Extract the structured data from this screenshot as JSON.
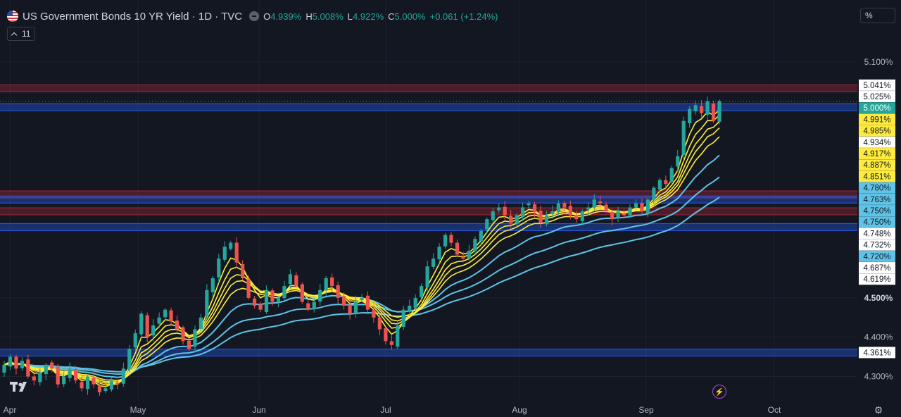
{
  "header": {
    "title": "US Government Bonds 10 YR Yield · 1D · TVC",
    "open_label": "O",
    "open": "4.939%",
    "high_label": "H",
    "high": "5.008%",
    "low_label": "L",
    "low": "4.922%",
    "close_label": "C",
    "close": "5.000%",
    "change": "+0.061 (+1.24%)",
    "indicator_count": "11",
    "scale_mode": "%"
  },
  "colors": {
    "background": "#131722",
    "up": "#26a69a",
    "down": "#ef5350",
    "ema_fast": "#ffeb3b",
    "ema_slow": "#5ec3e6",
    "resistance_band": "#b2283a",
    "support_band": "#2962ff"
  },
  "chart_data": {
    "type": "candlestick",
    "x_tick_labels": [
      "Apr",
      "May",
      "Jun",
      "Jul",
      "Aug",
      "Sep",
      "Oct"
    ],
    "y_tick_labels": [
      "5.100%",
      "4.500%",
      "4.400%",
      "4.300%"
    ],
    "ylim": [
      4.2,
      5.2
    ],
    "last_price": 5.0,
    "price_badges": [
      {
        "label": "5.041%",
        "value": 5.041,
        "style": "white"
      },
      {
        "label": "5.025%",
        "value": 5.025,
        "style": "white"
      },
      {
        "label": "5.000%",
        "value": 5.0,
        "style": "green"
      },
      {
        "label": "4.991%",
        "value": 4.991,
        "style": "yellow"
      },
      {
        "label": "4.985%",
        "value": 4.985,
        "style": "yellow"
      },
      {
        "label": "4.934%",
        "value": 4.934,
        "style": "white"
      },
      {
        "label": "4.917%",
        "value": 4.917,
        "style": "yellow"
      },
      {
        "label": "4.887%",
        "value": 4.887,
        "style": "yellow"
      },
      {
        "label": "4.851%",
        "value": 4.851,
        "style": "yellow"
      },
      {
        "label": "4.780%",
        "value": 4.78,
        "style": "blue"
      },
      {
        "label": "4.763%",
        "value": 4.763,
        "style": "blue"
      },
      {
        "label": "4.750%",
        "value": 4.75,
        "style": "blue"
      },
      {
        "label": "4.750%",
        "value": 4.75,
        "style": "blue"
      },
      {
        "label": "4.748%",
        "value": 4.748,
        "style": "white"
      },
      {
        "label": "4.732%",
        "value": 4.732,
        "style": "white"
      },
      {
        "label": "4.720%",
        "value": 4.72,
        "style": "blue"
      },
      {
        "label": "4.687%",
        "value": 4.687,
        "style": "white"
      },
      {
        "label": "4.619%",
        "value": 4.619,
        "style": "white"
      },
      {
        "label": "4.361%",
        "value": 4.361,
        "style": "white"
      }
    ],
    "horizontal_bands": [
      {
        "value": 5.033,
        "kind": "resistance"
      },
      {
        "value": 4.985,
        "kind": "support"
      },
      {
        "value": 4.763,
        "kind": "resistance"
      },
      {
        "value": 4.75,
        "kind": "support"
      },
      {
        "value": 4.72,
        "kind": "resistance"
      },
      {
        "value": 4.68,
        "kind": "support"
      },
      {
        "value": 4.361,
        "kind": "support"
      }
    ],
    "closes": [
      4.33,
      4.35,
      4.32,
      4.34,
      4.3,
      4.29,
      4.31,
      4.33,
      4.32,
      4.28,
      4.3,
      4.32,
      4.29,
      4.27,
      4.3,
      4.28,
      4.26,
      4.27,
      4.29,
      4.28,
      4.32,
      4.37,
      4.41,
      4.46,
      4.4,
      4.43,
      4.45,
      4.47,
      4.44,
      4.42,
      4.39,
      4.37,
      4.42,
      4.45,
      4.52,
      4.55,
      4.6,
      4.63,
      4.64,
      4.59,
      4.55,
      4.5,
      4.48,
      4.47,
      4.52,
      4.49,
      4.5,
      4.53,
      4.56,
      4.53,
      4.49,
      4.47,
      4.49,
      4.52,
      4.55,
      4.53,
      4.5,
      4.48,
      4.46,
      4.49,
      4.5,
      4.47,
      4.45,
      4.42,
      4.39,
      4.38,
      4.43,
      4.47,
      4.48,
      4.5,
      4.53,
      4.58,
      4.6,
      4.63,
      4.66,
      4.64,
      4.61,
      4.6,
      4.62,
      4.65,
      4.67,
      4.7,
      4.72,
      4.73,
      4.71,
      4.69,
      4.71,
      4.73,
      4.74,
      4.72,
      4.69,
      4.71,
      4.72,
      4.74,
      4.73,
      4.71,
      4.7,
      4.72,
      4.73,
      4.75,
      4.74,
      4.72,
      4.7,
      4.72,
      4.71,
      4.73,
      4.74,
      4.72,
      4.75,
      4.78,
      4.8,
      4.79,
      4.83,
      4.86,
      4.95,
      4.98,
      4.99,
      4.97,
      5.0,
      4.95,
      5.0
    ]
  }
}
